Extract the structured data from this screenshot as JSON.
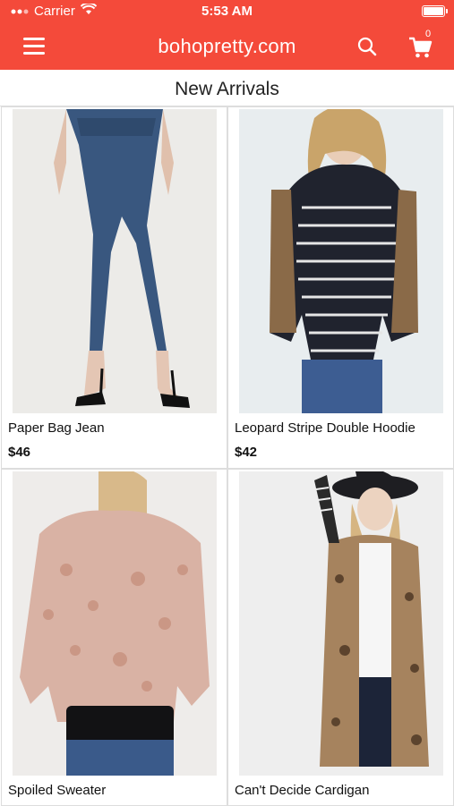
{
  "status_bar": {
    "carrier": "Carrier",
    "time": "5:53 AM"
  },
  "nav": {
    "title": "bohopretty.com",
    "cart_count": "0"
  },
  "section": {
    "title": "New Arrivals"
  },
  "products": [
    {
      "name": "Paper Bag Jean",
      "price": "$46",
      "image": "woman in high-waisted paper bag jeans with black heels"
    },
    {
      "name": "Leopard Stripe Double Hoodie",
      "price": "$42",
      "image": "woman in striped hoodie with leopard sleeves"
    },
    {
      "name": "Spoiled Sweater",
      "price": "",
      "image": "woman in pink metallic leopard sweater holding black clutch"
    },
    {
      "name": "Can't Decide Cardigan",
      "price": "",
      "image": "woman in leopard long cardigan with black hat"
    }
  ],
  "colors": {
    "brand": "#f44a3a"
  }
}
